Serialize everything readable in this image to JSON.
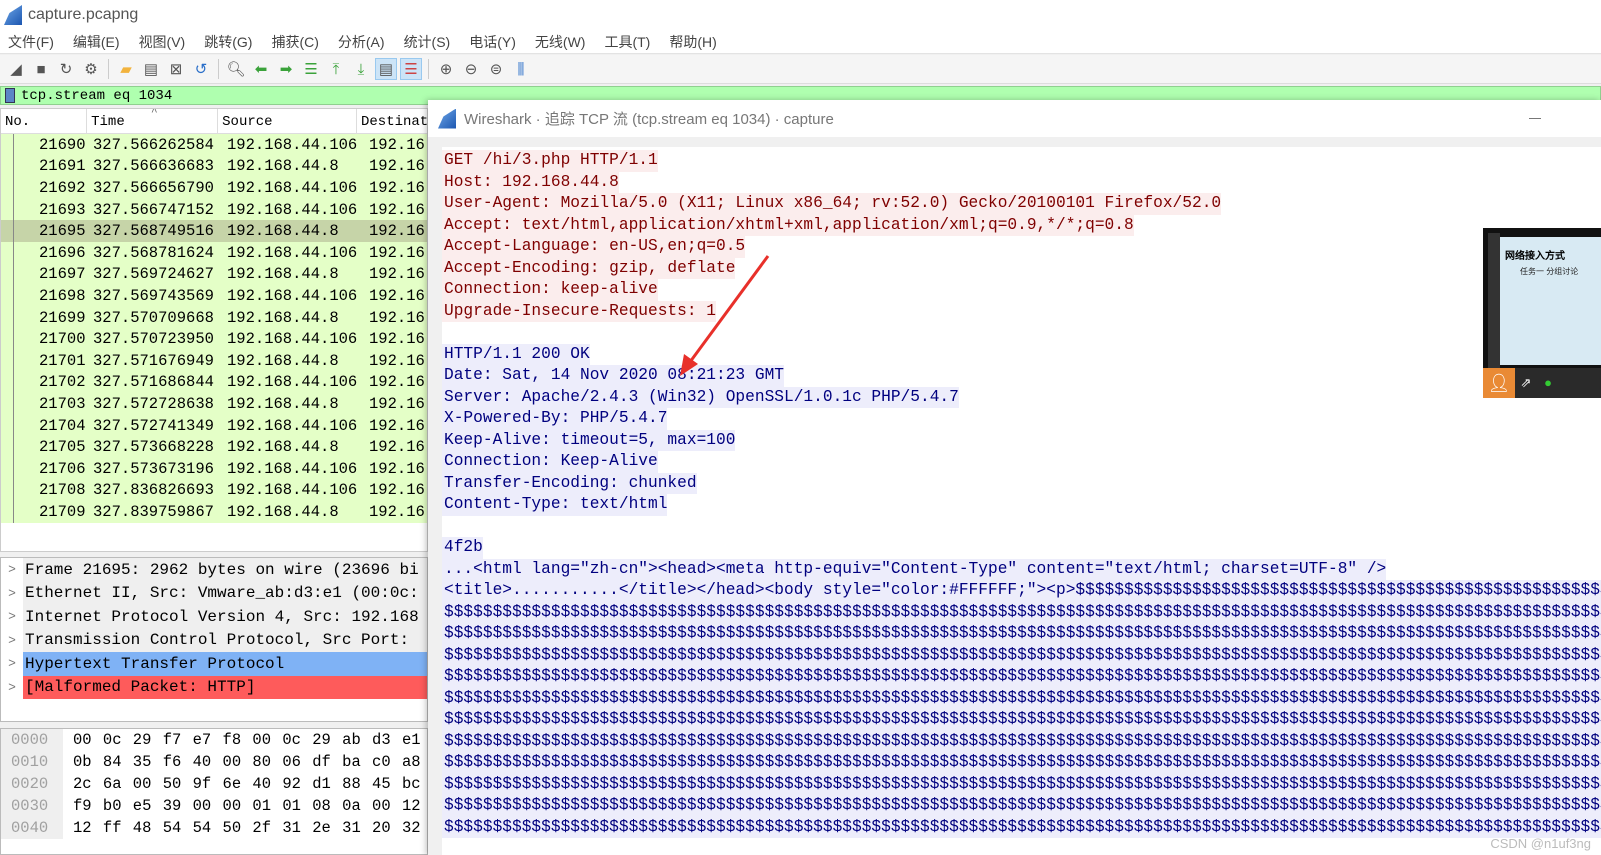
{
  "window": {
    "title": "capture.pcapng"
  },
  "menu": [
    "文件(F)",
    "编辑(E)",
    "视图(V)",
    "跳转(G)",
    "捕获(C)",
    "分析(A)",
    "统计(S)",
    "电话(Y)",
    "无线(W)",
    "工具(T)",
    "帮助(H)"
  ],
  "filter": {
    "value": "tcp.stream eq 1034"
  },
  "packet_list": {
    "columns": [
      "No.",
      "Time",
      "Source",
      "Destinat"
    ],
    "rows": [
      {
        "no": "21690",
        "time": "327.566262584",
        "src": "192.168.44.106",
        "dst": "192.16"
      },
      {
        "no": "21691",
        "time": "327.566636683",
        "src": "192.168.44.8",
        "dst": "192.16"
      },
      {
        "no": "21692",
        "time": "327.566656790",
        "src": "192.168.44.106",
        "dst": "192.16"
      },
      {
        "no": "21693",
        "time": "327.566747152",
        "src": "192.168.44.106",
        "dst": "192.16"
      },
      {
        "no": "21695",
        "time": "327.568749516",
        "src": "192.168.44.8",
        "dst": "192.16"
      },
      {
        "no": "21696",
        "time": "327.568781624",
        "src": "192.168.44.106",
        "dst": "192.16"
      },
      {
        "no": "21697",
        "time": "327.569724627",
        "src": "192.168.44.8",
        "dst": "192.16"
      },
      {
        "no": "21698",
        "time": "327.569743569",
        "src": "192.168.44.106",
        "dst": "192.16"
      },
      {
        "no": "21699",
        "time": "327.570709668",
        "src": "192.168.44.8",
        "dst": "192.16"
      },
      {
        "no": "21700",
        "time": "327.570723950",
        "src": "192.168.44.106",
        "dst": "192.16"
      },
      {
        "no": "21701",
        "time": "327.571676949",
        "src": "192.168.44.8",
        "dst": "192.16"
      },
      {
        "no": "21702",
        "time": "327.571686844",
        "src": "192.168.44.106",
        "dst": "192.16"
      },
      {
        "no": "21703",
        "time": "327.572728638",
        "src": "192.168.44.8",
        "dst": "192.16"
      },
      {
        "no": "21704",
        "time": "327.572741349",
        "src": "192.168.44.106",
        "dst": "192.16"
      },
      {
        "no": "21705",
        "time": "327.573668228",
        "src": "192.168.44.8",
        "dst": "192.16"
      },
      {
        "no": "21706",
        "time": "327.573673196",
        "src": "192.168.44.106",
        "dst": "192.16"
      },
      {
        "no": "21708",
        "time": "327.836826693",
        "src": "192.168.44.106",
        "dst": "192.16"
      },
      {
        "no": "21709",
        "time": "327.839759867",
        "src": "192.168.44.8",
        "dst": "192.16"
      }
    ],
    "selected": "21695"
  },
  "details": [
    "Frame 21695: 2962 bytes on wire (23696 bi",
    "Ethernet II, Src: Vmware_ab:d3:e1 (00:0c:",
    "Internet Protocol Version 4, Src: 192.168",
    "Transmission Control Protocol, Src Port: ",
    "Hypertext Transfer Protocol",
    "[Malformed Packet: HTTP]"
  ],
  "bytes": [
    {
      "off": "0000",
      "hex": "00 0c 29 f7 e7 f8 00 0c  29 ab d3 e1"
    },
    {
      "off": "0010",
      "hex": "0b 84 35 f6 40 00 80 06  df ba c0 a8"
    },
    {
      "off": "0020",
      "hex": "2c 6a 00 50 9f 6e 40 92  d1 88 45 bc"
    },
    {
      "off": "0030",
      "hex": "f9 b0 e5 39 00 00 01 01  08 0a 00 12"
    },
    {
      "off": "0040",
      "hex": "12 ff 48 54 54 50 2f 31  2e 31 20 32"
    }
  ],
  "follow": {
    "title": "Wireshark · 追踪 TCP 流 (tcp.stream eq 1034) · capture",
    "request": [
      "GET /hi/3.php HTTP/1.1",
      "Host: 192.168.44.8",
      "User-Agent: Mozilla/5.0 (X11; Linux x86_64; rv:52.0) Gecko/20100101 Firefox/52.0",
      "Accept: text/html,application/xhtml+xml,application/xml;q=0.9,*/*;q=0.8",
      "Accept-Language: en-US,en;q=0.5",
      "Accept-Encoding: gzip, deflate",
      "Connection: keep-alive",
      "Upgrade-Insecure-Requests: 1"
    ],
    "response": [
      "HTTP/1.1 200 OK",
      "Date: Sat, 14 Nov 2020 08:21:23 GMT",
      "Server: Apache/2.4.3 (Win32) OpenSSL/1.0.1c PHP/5.4.7",
      "X-Powered-By: PHP/5.4.7",
      "Keep-Alive: timeout=5, max=100",
      "Connection: Keep-Alive",
      "Transfer-Encoding: chunked",
      "Content-Type: text/html"
    ],
    "body": [
      "4f2b",
      "...<html lang=\"zh-cn\"><head><meta http-equiv=\"Content-Type\" content=\"text/html; charset=UTF-8\" />",
      "<title>...........</title></head><body style=\"color:#FFFFFF;\"><p>$$$$$$$$$$$$$$$$$$$$$$$$$$$$$$$$$$$$$$$$$$$$$$$$$$$$$$$$$$$$$$$$$$"
    ],
    "dollar_line": "$$$$$$$$$$$$$$$$$$$$$$$$$$$$$$$$$$$$$$$$$$$$$$$$$$$$$$$$$$$$$$$$$$$$$$$$$$$$$$$$$$$$$$$$$$$$$$$$$$$$$$$$$$$$$$$$$$$$$$$$$$$$$$$$$$$"
  },
  "overlay": {
    "slide_title": "网络接入方式",
    "slide_subtitle": "任务一 分组讨论"
  },
  "watermark": "CSDN @n1uf3ng",
  "colors": {
    "client": "#7f0000",
    "server": "#00007f",
    "filter_ok": "#afffaf",
    "http": "#7fb2f5",
    "malformed": "#fe5b5b",
    "annotation_arrow": "#e8302a"
  }
}
